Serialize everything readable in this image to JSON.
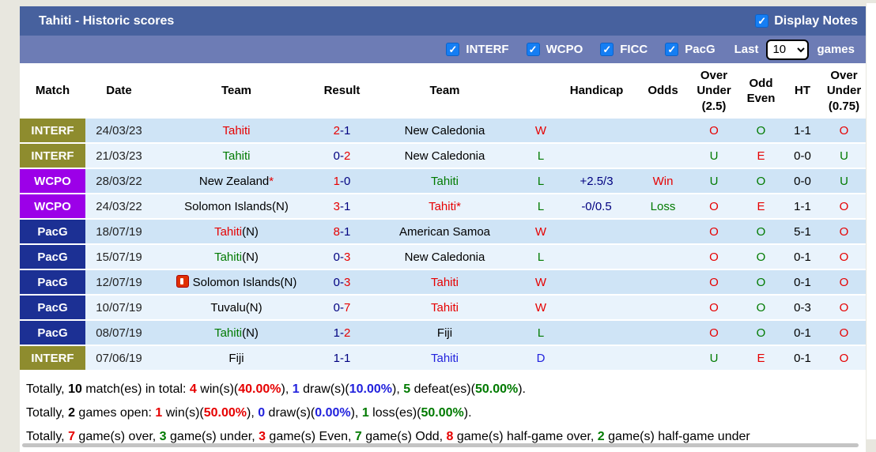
{
  "title": "Tahiti - Historic scores",
  "display_notes_label": "Display Notes",
  "filters": {
    "competitions": [
      {
        "label": "INTERF",
        "checked": true
      },
      {
        "label": "WCPO",
        "checked": true
      },
      {
        "label": "FICC",
        "checked": true
      },
      {
        "label": "PacG",
        "checked": true
      }
    ],
    "last_label": "Last",
    "last_value": "10",
    "games_label": "games"
  },
  "colors": {
    "red": "#e60000",
    "green": "#007a00",
    "blue": "#2222dd",
    "navy": "#000080",
    "black": "#000000"
  },
  "match_colors": {
    "INTERF": "#8e8c2e",
    "WCPO": "#9c00e8",
    "PacG": "#1c3094"
  },
  "table": {
    "headers": [
      "Match",
      "Date",
      "Team",
      "Result",
      "Team",
      "",
      "Handicap",
      "Odds",
      "Over Under (2.5)",
      "Odd Even",
      "HT",
      "Over Under (0.75)"
    ],
    "rows": [
      {
        "match": "INTERF",
        "date": "24/03/23",
        "team1": [
          [
            "Tahiti",
            "red"
          ]
        ],
        "result": [
          [
            "2",
            "red"
          ],
          [
            "-",
            "navy"
          ],
          [
            "1",
            "navy"
          ]
        ],
        "team2": [
          [
            "New Caledonia",
            "black"
          ]
        ],
        "wdl": [
          "W",
          "red"
        ],
        "handicap": null,
        "odds": null,
        "ou25": [
          "O",
          "red"
        ],
        "oddeven": [
          "O",
          "green"
        ],
        "ht": "1-1",
        "ou075": [
          "O",
          "red"
        ]
      },
      {
        "match": "INTERF",
        "date": "21/03/23",
        "team1": [
          [
            "Tahiti",
            "green"
          ]
        ],
        "result": [
          [
            "0",
            "navy"
          ],
          [
            "-",
            "navy"
          ],
          [
            "2",
            "red"
          ]
        ],
        "team2": [
          [
            "New Caledonia",
            "black"
          ]
        ],
        "wdl": [
          "L",
          "green"
        ],
        "handicap": null,
        "odds": null,
        "ou25": [
          "U",
          "green"
        ],
        "oddeven": [
          "E",
          "red"
        ],
        "ht": "0-0",
        "ou075": [
          "U",
          "green"
        ]
      },
      {
        "match": "WCPO",
        "date": "28/03/22",
        "team1": [
          [
            "New Zealand",
            "black"
          ],
          [
            "*",
            "red"
          ]
        ],
        "result": [
          [
            "1",
            "red"
          ],
          [
            "-",
            "navy"
          ],
          [
            "0",
            "navy"
          ]
        ],
        "team2": [
          [
            "Tahiti",
            "green"
          ]
        ],
        "wdl": [
          "L",
          "green"
        ],
        "handicap": [
          "+2.5/3",
          "navy"
        ],
        "odds": [
          "Win",
          "red"
        ],
        "ou25": [
          "U",
          "green"
        ],
        "oddeven": [
          "O",
          "green"
        ],
        "ht": "0-0",
        "ou075": [
          "U",
          "green"
        ]
      },
      {
        "match": "WCPO",
        "date": "24/03/22",
        "team1": [
          [
            "Solomon Islands(N)",
            "black"
          ]
        ],
        "result": [
          [
            "3",
            "red"
          ],
          [
            "-",
            "navy"
          ],
          [
            "1",
            "navy"
          ]
        ],
        "team2": [
          [
            "Tahiti",
            "red"
          ],
          [
            "*",
            "red"
          ]
        ],
        "wdl": [
          "L",
          "green"
        ],
        "handicap": [
          "-0/0.5",
          "navy"
        ],
        "odds": [
          "Loss",
          "green"
        ],
        "ou25": [
          "O",
          "red"
        ],
        "oddeven": [
          "E",
          "red"
        ],
        "ht": "1-1",
        "ou075": [
          "O",
          "red"
        ]
      },
      {
        "match": "PacG",
        "date": "18/07/19",
        "team1": [
          [
            "Tahiti",
            "red"
          ],
          [
            "(N)",
            "black"
          ]
        ],
        "result": [
          [
            "8",
            "red"
          ],
          [
            "-",
            "navy"
          ],
          [
            "1",
            "navy"
          ]
        ],
        "team2": [
          [
            "American Samoa",
            "black"
          ]
        ],
        "wdl": [
          "W",
          "red"
        ],
        "handicap": null,
        "odds": null,
        "ou25": [
          "O",
          "red"
        ],
        "oddeven": [
          "O",
          "green"
        ],
        "ht": "5-1",
        "ou075": [
          "O",
          "red"
        ]
      },
      {
        "match": "PacG",
        "date": "15/07/19",
        "team1": [
          [
            "Tahiti",
            "green"
          ],
          [
            "(N)",
            "black"
          ]
        ],
        "result": [
          [
            "0",
            "navy"
          ],
          [
            "-",
            "navy"
          ],
          [
            "3",
            "red"
          ]
        ],
        "team2": [
          [
            "New Caledonia",
            "black"
          ]
        ],
        "wdl": [
          "L",
          "green"
        ],
        "handicap": null,
        "odds": null,
        "ou25": [
          "O",
          "red"
        ],
        "oddeven": [
          "O",
          "green"
        ],
        "ht": "0-1",
        "ou075": [
          "O",
          "red"
        ]
      },
      {
        "match": "PacG",
        "date": "12/07/19",
        "icon1": "red-card",
        "team1": [
          [
            "Solomon Islands(N)",
            "black"
          ]
        ],
        "result": [
          [
            "0",
            "navy"
          ],
          [
            "-",
            "navy"
          ],
          [
            "3",
            "red"
          ]
        ],
        "team2": [
          [
            "Tahiti",
            "red"
          ]
        ],
        "wdl": [
          "W",
          "red"
        ],
        "handicap": null,
        "odds": null,
        "ou25": [
          "O",
          "red"
        ],
        "oddeven": [
          "O",
          "green"
        ],
        "ht": "0-1",
        "ou075": [
          "O",
          "red"
        ]
      },
      {
        "match": "PacG",
        "date": "10/07/19",
        "team1": [
          [
            "Tuvalu(N)",
            "black"
          ]
        ],
        "result": [
          [
            "0",
            "navy"
          ],
          [
            "-",
            "navy"
          ],
          [
            "7",
            "red"
          ]
        ],
        "team2": [
          [
            "Tahiti",
            "red"
          ]
        ],
        "wdl": [
          "W",
          "red"
        ],
        "handicap": null,
        "odds": null,
        "ou25": [
          "O",
          "red"
        ],
        "oddeven": [
          "O",
          "green"
        ],
        "ht": "0-3",
        "ou075": [
          "O",
          "red"
        ]
      },
      {
        "match": "PacG",
        "date": "08/07/19",
        "team1": [
          [
            "Tahiti",
            "green"
          ],
          [
            "(N)",
            "black"
          ]
        ],
        "result": [
          [
            "1",
            "navy"
          ],
          [
            "-",
            "navy"
          ],
          [
            "2",
            "red"
          ]
        ],
        "team2": [
          [
            "Fiji",
            "black"
          ]
        ],
        "wdl": [
          "L",
          "green"
        ],
        "handicap": null,
        "odds": null,
        "ou25": [
          "O",
          "red"
        ],
        "oddeven": [
          "O",
          "green"
        ],
        "ht": "0-1",
        "ou075": [
          "O",
          "red"
        ]
      },
      {
        "match": "INTERF",
        "date": "07/06/19",
        "team1": [
          [
            "Fiji",
            "black"
          ]
        ],
        "result": [
          [
            "1",
            "navy"
          ],
          [
            "-",
            "navy"
          ],
          [
            "1",
            "navy"
          ]
        ],
        "team2": [
          [
            "Tahiti",
            "blue"
          ]
        ],
        "wdl": [
          "D",
          "blue"
        ],
        "handicap": null,
        "odds": null,
        "ou25": [
          "U",
          "green"
        ],
        "oddeven": [
          "E",
          "red"
        ],
        "ht": "0-1",
        "ou075": [
          "O",
          "red"
        ]
      }
    ]
  },
  "summary": {
    "lines": [
      [
        [
          "Totally, ",
          "black"
        ],
        [
          "10",
          "black",
          "b"
        ],
        [
          " match(es) in total: ",
          "black"
        ],
        [
          "4",
          "red",
          "b"
        ],
        [
          " win(s)(",
          "black"
        ],
        [
          "40.00%",
          "red",
          "b"
        ],
        [
          "), ",
          "black"
        ],
        [
          "1",
          "blue",
          "b"
        ],
        [
          " draw(s)(",
          "black"
        ],
        [
          "10.00%",
          "blue",
          "b"
        ],
        [
          "), ",
          "black"
        ],
        [
          "5",
          "green",
          "b"
        ],
        [
          " defeat(es)(",
          "black"
        ],
        [
          "50.00%",
          "green",
          "b"
        ],
        [
          ").",
          "black"
        ]
      ],
      [
        [
          "Totally, ",
          "black"
        ],
        [
          "2",
          "black",
          "b"
        ],
        [
          " games open: ",
          "black"
        ],
        [
          "1",
          "red",
          "b"
        ],
        [
          " win(s)(",
          "black"
        ],
        [
          "50.00%",
          "red",
          "b"
        ],
        [
          "), ",
          "black"
        ],
        [
          "0",
          "blue",
          "b"
        ],
        [
          " draw(s)(",
          "black"
        ],
        [
          "0.00%",
          "blue",
          "b"
        ],
        [
          "), ",
          "black"
        ],
        [
          "1",
          "green",
          "b"
        ],
        [
          " loss(es)(",
          "black"
        ],
        [
          "50.00%",
          "green",
          "b"
        ],
        [
          ").",
          "black"
        ]
      ],
      [
        [
          "Totally, ",
          "black"
        ],
        [
          "7",
          "red",
          "b"
        ],
        [
          " game(s) over, ",
          "black"
        ],
        [
          "3",
          "green",
          "b"
        ],
        [
          " game(s) under, ",
          "black"
        ],
        [
          "3",
          "red",
          "b"
        ],
        [
          " game(s) Even, ",
          "black"
        ],
        [
          "7",
          "green",
          "b"
        ],
        [
          " game(s) Odd, ",
          "black"
        ],
        [
          "8",
          "red",
          "b"
        ],
        [
          " game(s) half-game over, ",
          "black"
        ],
        [
          "2",
          "green",
          "b"
        ],
        [
          " game(s) half-game under",
          "black"
        ]
      ]
    ]
  },
  "checkmark_glyph": "✓"
}
